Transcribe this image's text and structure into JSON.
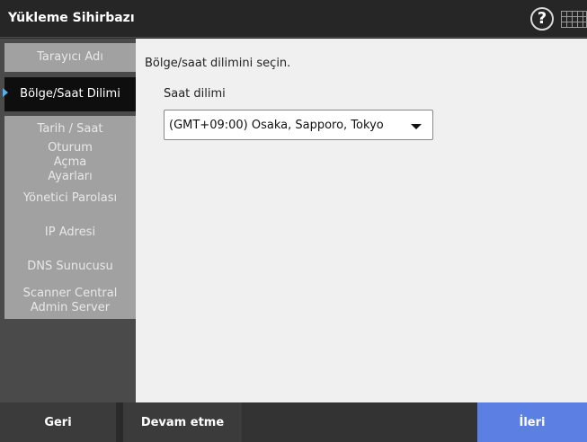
{
  "header": {
    "title": "Yükleme Sihirbazı",
    "help_glyph": "?",
    "icons": [
      "help-icon",
      "keyboard-icon"
    ]
  },
  "sidebar": {
    "active_index": 1,
    "items": [
      {
        "label": "Tarayıcı Adı"
      },
      {
        "label": "Bölge/Saat Dilimi"
      },
      {
        "label": "Tarih / Saat"
      },
      {
        "label": "Oturum Açma Ayarları"
      },
      {
        "label": "Yönetici Parolası"
      },
      {
        "label": "IP Adresi"
      },
      {
        "label": "DNS Sunucusu"
      },
      {
        "label": "Scanner Central Admin Server"
      }
    ]
  },
  "main": {
    "instruction": "Bölge/saat dilimini seçin.",
    "timezone_label": "Saat dilimi",
    "timezone_value": "(GMT+09:00) Osaka, Sapporo, Tokyo"
  },
  "footer": {
    "back_label": "Geri",
    "continue_label": "Devam etme",
    "next_label": "İleri"
  },
  "colors": {
    "accent": "#5b7fe3",
    "active_marker": "#4fb1f2"
  }
}
